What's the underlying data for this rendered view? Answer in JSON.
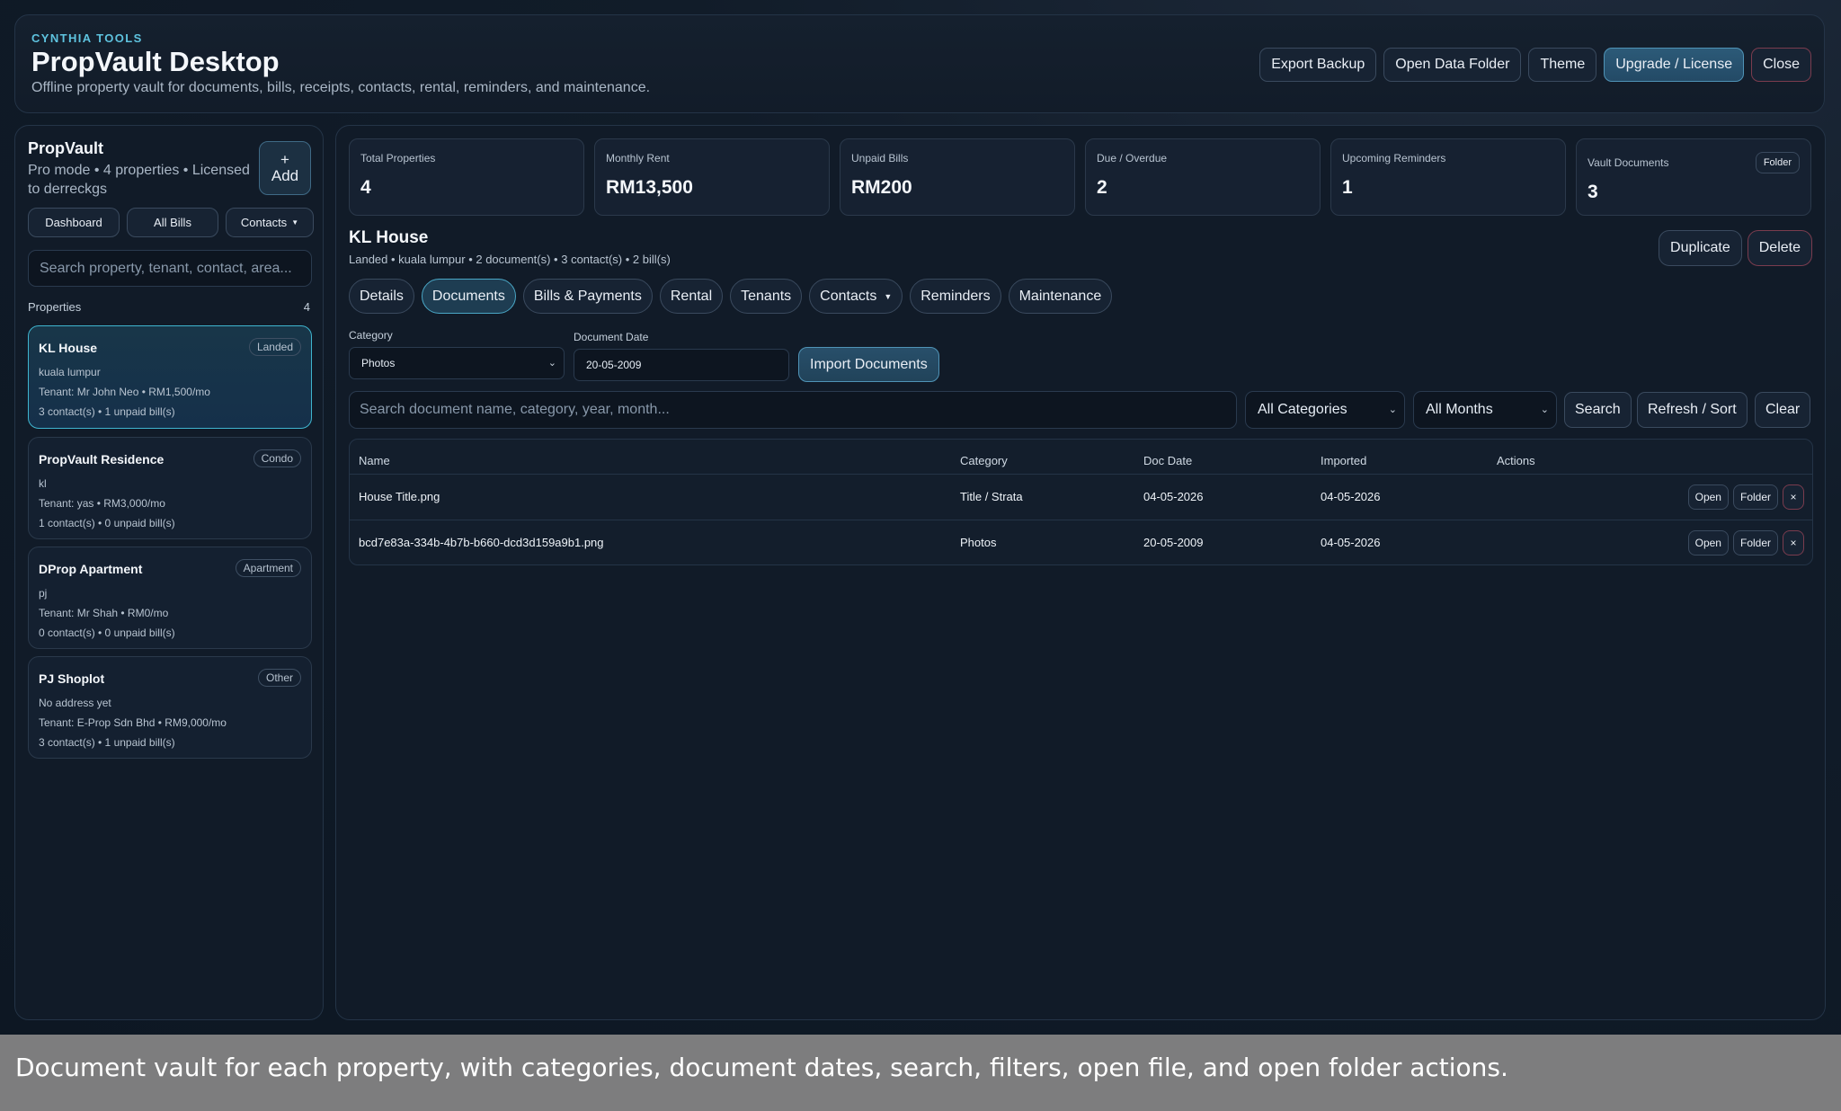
{
  "header": {
    "brand": "CYNTHIA TOOLS",
    "title": "PropVault Desktop",
    "subtitle": "Offline property vault for documents, bills, receipts, contacts, rental, reminders, and maintenance.",
    "actions": [
      "Export Backup",
      "Open Data Folder",
      "Theme",
      "Upgrade / License",
      "Close"
    ]
  },
  "sidebar": {
    "title": "PropVault",
    "mode": "Pro mode • 4 properties • Licensed to derreckgs",
    "add_plus": "+",
    "add_label": "Add",
    "nav": [
      "Dashboard",
      "All Bills",
      "Contacts"
    ],
    "search_placeholder": "Search property, tenant, contact, area...",
    "properties_label": "Properties",
    "properties_count": "4",
    "properties": [
      {
        "name": "KL House",
        "type": "Landed",
        "address": "kuala lumpur",
        "tenant": "Tenant: Mr John Neo • RM1,500/mo",
        "summary": "3 contact(s) • 1 unpaid bill(s)"
      },
      {
        "name": "PropVault Residence",
        "type": "Condo",
        "address": "kl",
        "tenant": "Tenant: yas • RM3,000/mo",
        "summary": "1 contact(s) • 0 unpaid bill(s)"
      },
      {
        "name": "DProp Apartment",
        "type": "Apartment",
        "address": "pj",
        "tenant": "Tenant: Mr Shah • RM0/mo",
        "summary": "0 contact(s) • 0 unpaid bill(s)"
      },
      {
        "name": "PJ Shoplot",
        "type": "Other",
        "address": "No address yet",
        "tenant": "Tenant: E-Prop Sdn Bhd • RM9,000/mo",
        "summary": "3 contact(s) • 1 unpaid bill(s)"
      }
    ]
  },
  "stats": [
    {
      "label": "Total Properties",
      "value": "4"
    },
    {
      "label": "Monthly Rent",
      "value": "RM13,500"
    },
    {
      "label": "Unpaid Bills",
      "value": "RM200"
    },
    {
      "label": "Due / Overdue",
      "value": "2"
    },
    {
      "label": "Upcoming Reminders",
      "value": "1"
    },
    {
      "label": "Vault Documents",
      "value": "3",
      "button": "Folder"
    }
  ],
  "property": {
    "title": "KL House",
    "meta": "Landed • kuala lumpur • 2 document(s) • 3 contact(s) • 2 bill(s)",
    "actions": [
      "Duplicate",
      "Delete"
    ]
  },
  "tabs": [
    "Details",
    "Documents",
    "Bills & Payments",
    "Rental",
    "Tenants",
    "Contacts",
    "Reminders",
    "Maintenance"
  ],
  "import": {
    "category_label": "Category",
    "category_value": "Photos",
    "date_label": "Document Date",
    "date_value": "20-05-2009",
    "button": "Import Documents"
  },
  "filters": {
    "search_placeholder": "Search document name, category, year, month...",
    "category": "All Categories",
    "month": "All Months",
    "buttons": [
      "Search",
      "Refresh / Sort",
      "Clear"
    ]
  },
  "table": {
    "columns": [
      "Name",
      "Category",
      "Doc Date",
      "Imported",
      "Actions"
    ],
    "rows": [
      {
        "name": "House Title.png",
        "category": "Title / Strata",
        "doc_date": "04-05-2026",
        "imported": "04-05-2026"
      },
      {
        "name": "bcd7e83a-334b-4b7b-b660-dcd3d159a9b1.png",
        "category": "Photos",
        "doc_date": "20-05-2009",
        "imported": "04-05-2026"
      }
    ],
    "row_actions": [
      "Open",
      "Folder",
      "×"
    ]
  },
  "caption": "Document vault for each property, with categories, document dates, search, filters, open file, and open folder actions."
}
